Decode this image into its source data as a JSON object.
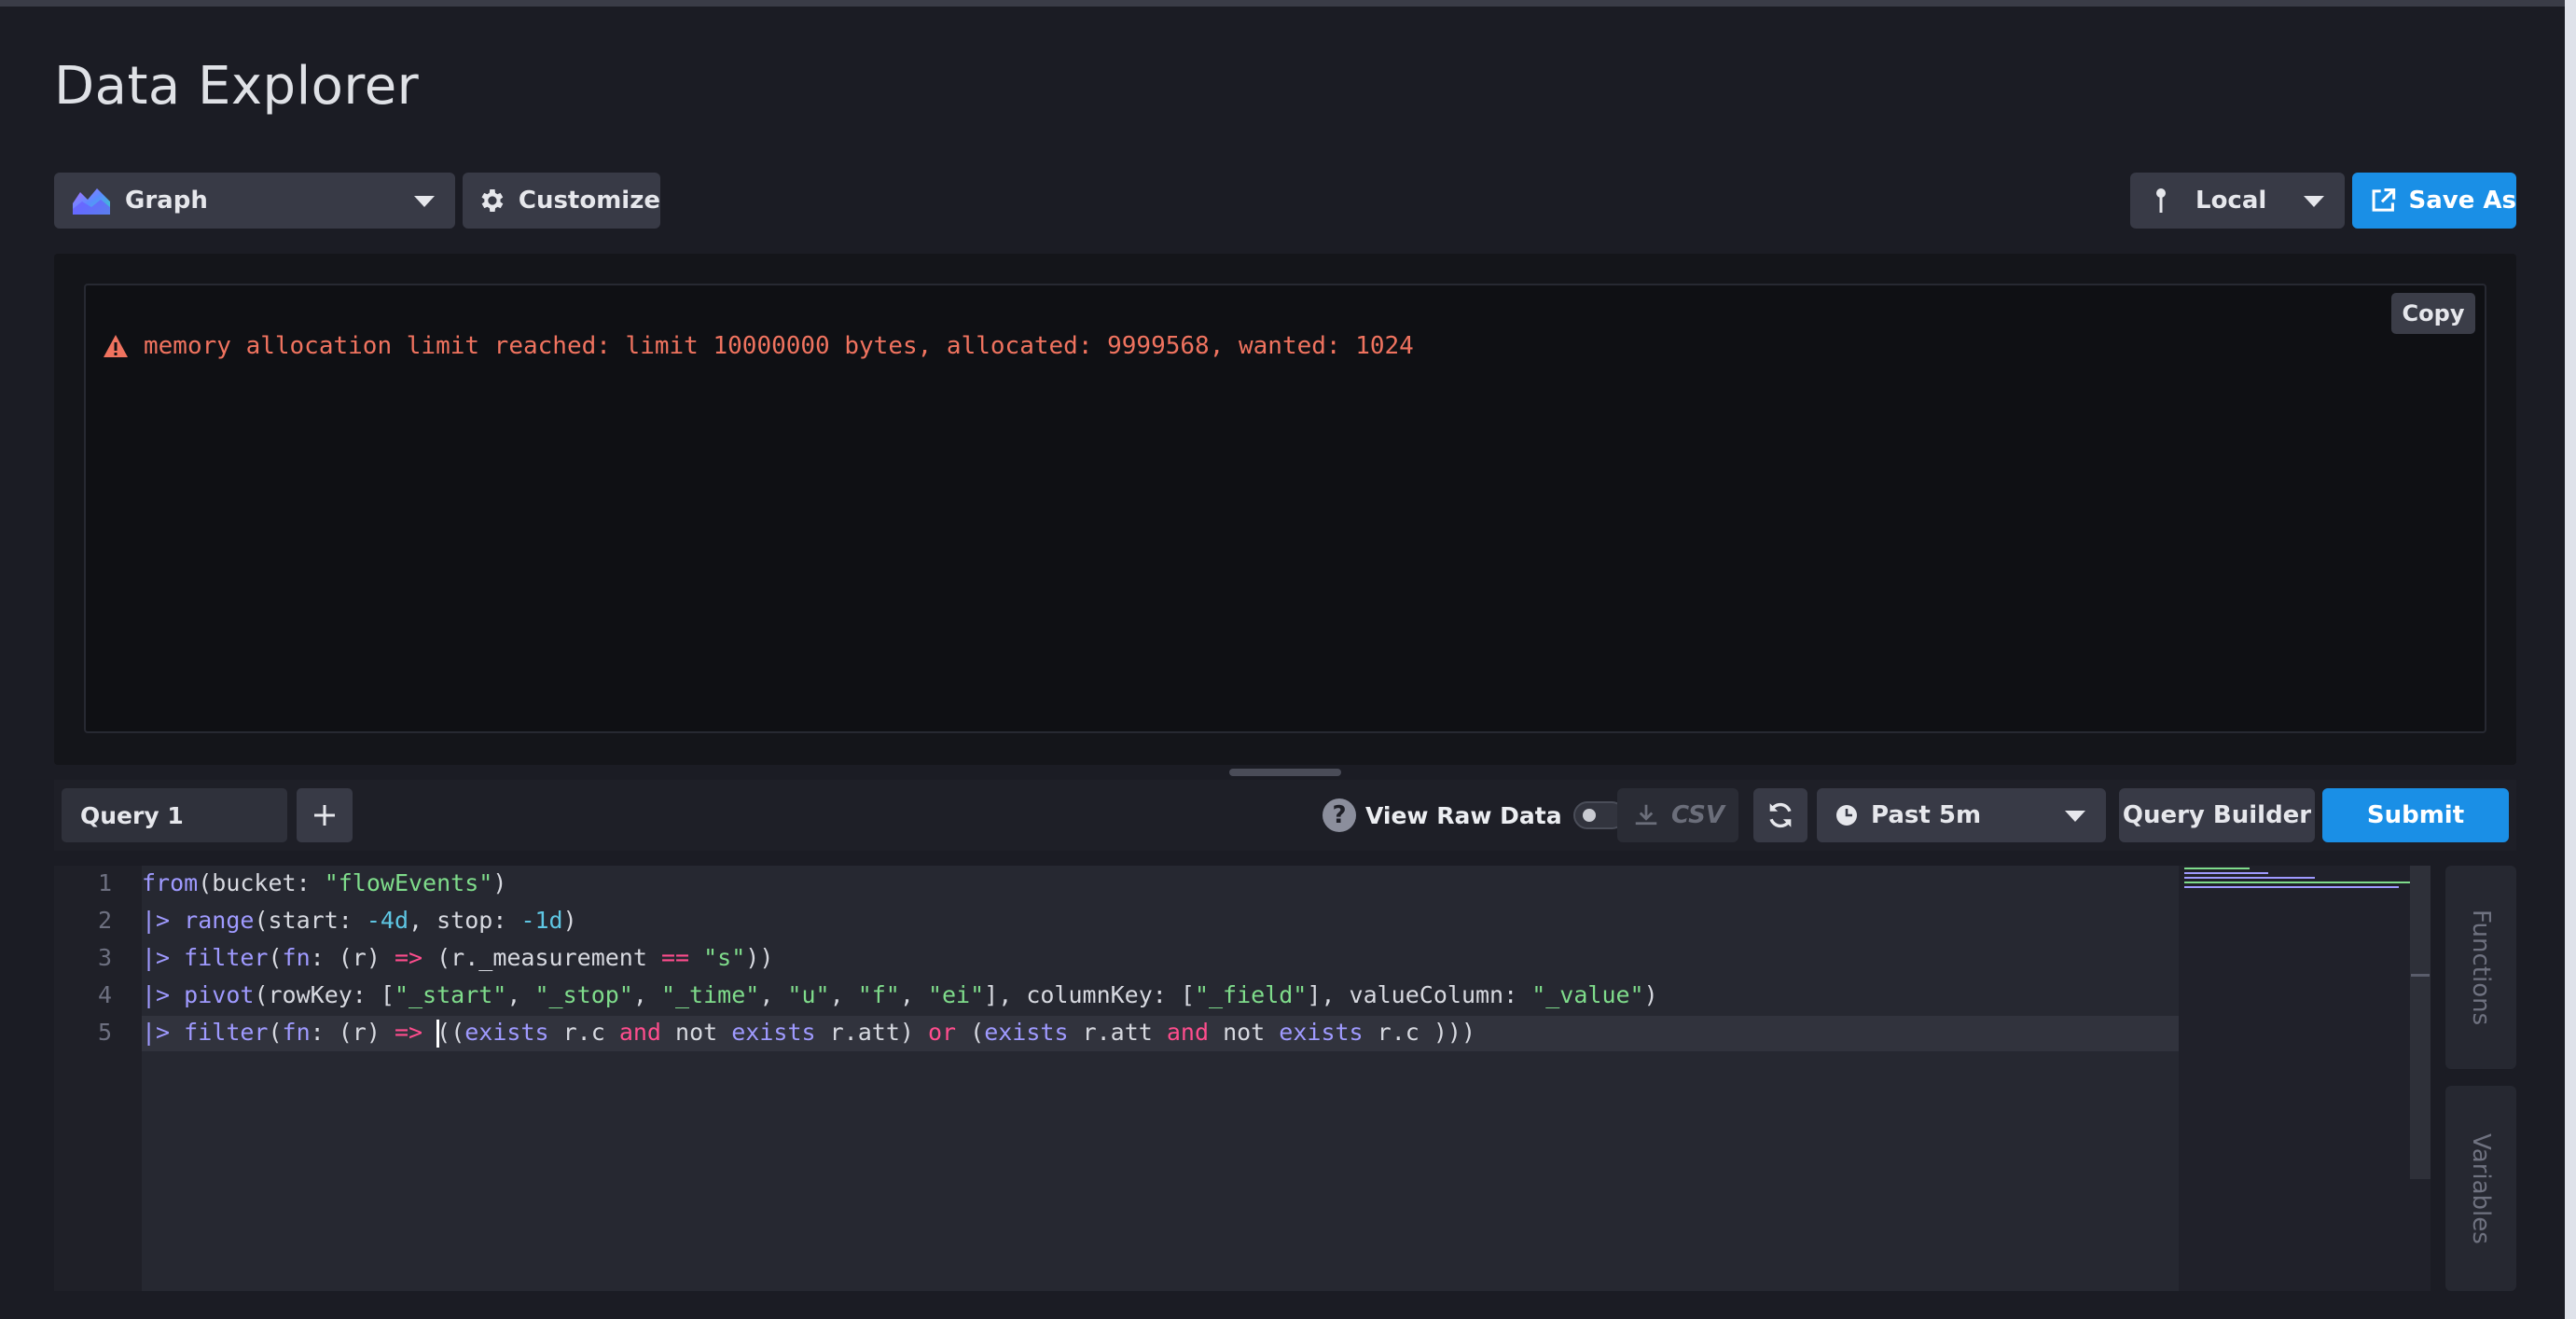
{
  "page": {
    "title": "Data Explorer"
  },
  "toolbar": {
    "graph_label": "Graph",
    "customize_label": "Customize",
    "local_label": "Local",
    "save_as_label": "Save As"
  },
  "output": {
    "copy_label": "Copy",
    "error_message": "memory allocation limit reached: limit 10000000 bytes, allocated: 9999568, wanted: 1024"
  },
  "query_bar": {
    "tab_label": "Query 1",
    "add_label": "+",
    "raw_data_label": "View Raw Data",
    "raw_data_enabled": false,
    "csv_label": "CSV",
    "time_range_label": "Past 5m",
    "query_builder_label": "Query Builder",
    "submit_label": "Submit"
  },
  "editor": {
    "line_numbers": [
      "1",
      "2",
      "3",
      "4",
      "5"
    ],
    "lines": [
      "from(bucket: \"flowEvents\")",
      "|> range(start: -4d, stop: -1d)",
      "|> filter(fn: (r) => (r._measurement == \"s\"))",
      "|> pivot(rowKey: [\"_start\", \"_stop\", \"_time\", \"u\", \"f\", \"ei\"], columnKey: [\"_field\"], valueColumn: \"_value\")",
      "|> filter(fn: (r) => ((exists r.c and not exists r.att) or (exists r.att and not exists r.c )))"
    ]
  },
  "side_tabs": {
    "functions_label": "Functions",
    "variables_label": "Variables"
  },
  "colors": {
    "accent": "#1a8fe6",
    "error": "#f0735f",
    "string": "#7fdc8b",
    "keyword": "#9f9aff",
    "operator": "#ff4d8d",
    "number": "#5ec6e3"
  }
}
